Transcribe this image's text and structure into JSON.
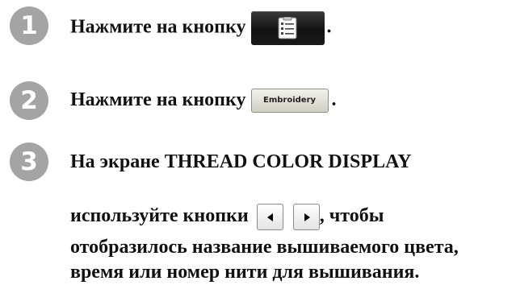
{
  "steps": [
    {
      "number": "1",
      "text_before": "Нажмите на кнопку",
      "text_after": "."
    },
    {
      "number": "2",
      "text_before": "Нажмите на кнопку",
      "button_label": "Embroidery",
      "text_after": "."
    },
    {
      "number": "3",
      "line1": "На экране THREAD COLOR DISPLAY",
      "line2_before": "используйте кнопки",
      "line2_after": ", чтобы",
      "line3": "отобразилось название вышиваемого цвета,",
      "line4": "время или номер нити для вышивания."
    }
  ],
  "icons": {
    "step1_button_icon": "checklist-icon",
    "left_arrow": "left-arrow-icon",
    "right_arrow": "right-arrow-icon"
  },
  "colors": {
    "badge": "#a4a4a4",
    "dark_button": "#111111",
    "text": "#111111"
  }
}
